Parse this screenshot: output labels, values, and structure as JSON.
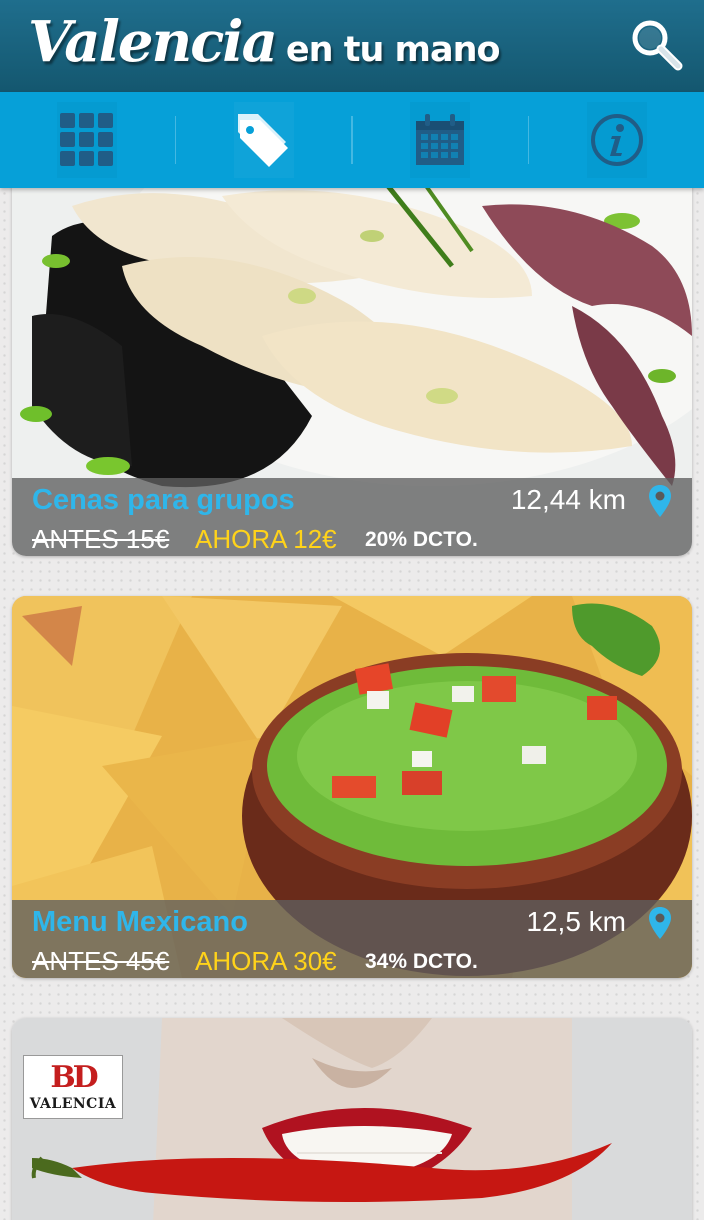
{
  "header": {
    "title_main": "Valencia",
    "title_sub": "en tu mano",
    "search_icon": "search-icon"
  },
  "tabs": [
    {
      "id": "categories",
      "icon": "grid-icon",
      "active": false
    },
    {
      "id": "offers",
      "icon": "tag-icon",
      "active": true
    },
    {
      "id": "events",
      "icon": "calendar-icon",
      "active": false
    },
    {
      "id": "info",
      "icon": "info-icon",
      "active": false
    }
  ],
  "colors": {
    "header": "#1a6785",
    "tabbar": "#06a0d8",
    "title_accent": "#2fb6ea",
    "price_now": "#ffd31a"
  },
  "deals": [
    {
      "title": "Cenas para grupos",
      "distance": "12,44 km",
      "price_before": "ANTES 15€",
      "price_now": "AHORA 12€",
      "discount": "20% DCTO."
    },
    {
      "title": "Menu Mexicano",
      "distance": "12,5 km",
      "price_before": "ANTES 45€",
      "price_now": "AHORA 30€",
      "discount": "34% DCTO."
    },
    {
      "logo_mark": "BD",
      "logo_text": "VALENCIA"
    }
  ]
}
